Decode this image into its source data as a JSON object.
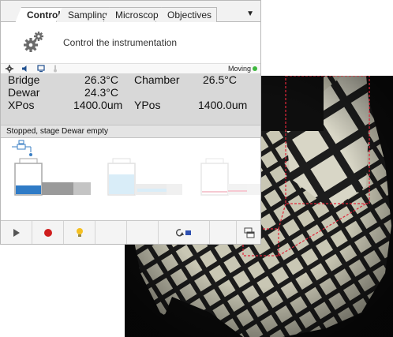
{
  "tabs": [
    {
      "label": "Control",
      "active": true
    },
    {
      "label": "Sampling",
      "active": false
    },
    {
      "label": "Microscope",
      "active": false
    },
    {
      "label": "Objectives",
      "active": false
    }
  ],
  "header": {
    "title": "Control the instrumentation",
    "icon": "gears-icon"
  },
  "status_icons": [
    "gear-icon",
    "speaker-icon",
    "monitor-icon",
    "thermometer-icon"
  ],
  "motion": {
    "label": "Moving",
    "color": "#3db83d"
  },
  "readings": {
    "bridge": {
      "label": "Bridge",
      "value": "26.3°C"
    },
    "chamber": {
      "label": "Chamber",
      "value": "26.5°C"
    },
    "dewar": {
      "label": "Dewar",
      "value": "24.3°C"
    },
    "xpos": {
      "label": "XPos",
      "value": "1400.0um"
    },
    "ypos": {
      "label": "YPos",
      "value": "1400.0um"
    }
  },
  "status_message": "Stopped, stage Dewar empty",
  "vessels": [
    {
      "name": "stage-dewar",
      "active": true
    },
    {
      "name": "autoloader-dewar",
      "active": false
    },
    {
      "name": "transfer-dewar",
      "active": false
    }
  ],
  "toolbar": [
    "play-icon",
    "record-icon",
    "bulb-icon",
    "blank",
    "blank",
    "cycle-icon",
    "blank",
    "window-stack-icon"
  ],
  "colors": {
    "accent": "#3a7fc4",
    "selection": "#e0263a",
    "panel_gray": "#d8d8d8"
  }
}
